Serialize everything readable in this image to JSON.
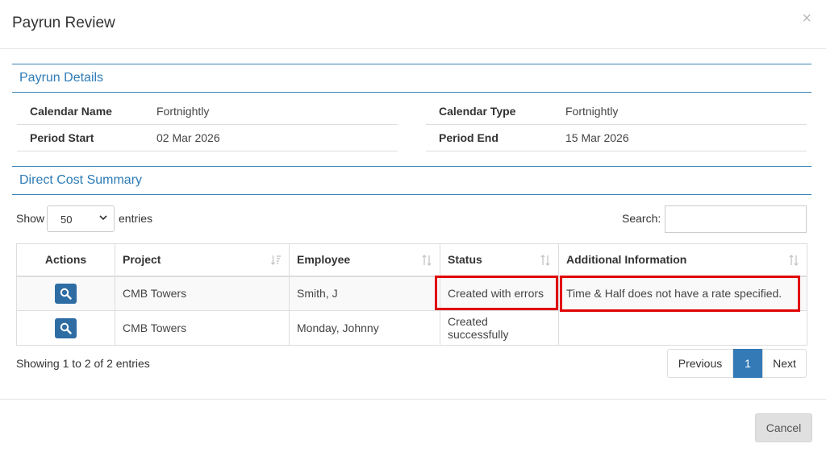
{
  "modal": {
    "title": "Payrun Review",
    "close": "×"
  },
  "payrun_details": {
    "heading": "Payrun Details",
    "fields": [
      {
        "label": "Calendar Name",
        "value": "Fortnightly"
      },
      {
        "label": "Calendar Type",
        "value": "Fortnightly"
      },
      {
        "label": "Period Start",
        "value": "02 Mar 2026"
      },
      {
        "label": "Period End",
        "value": "15 Mar 2026"
      }
    ]
  },
  "direct_cost": {
    "heading": "Direct Cost Summary",
    "length": {
      "show_label": "Show",
      "selected": "50",
      "entries_label": "entries"
    },
    "search": {
      "label": "Search:",
      "value": ""
    },
    "columns": [
      "Actions",
      "Project",
      "Employee",
      "Status",
      "Additional Information"
    ],
    "rows": [
      {
        "project": "CMB Towers",
        "employee": "Smith, J",
        "status": "Created with errors",
        "info": "Time & Half does not have a rate specified."
      },
      {
        "project": "CMB Towers",
        "employee": "Monday, Johnny",
        "status": "Created successfully",
        "info": ""
      }
    ],
    "info": "Showing 1 to 2 of 2 entries",
    "pagination": {
      "previous": "Previous",
      "current": "1",
      "next": "Next"
    }
  },
  "footer": {
    "cancel_label": "Cancel"
  },
  "colors": {
    "accent": "#337ab7",
    "highlight": "#e00000",
    "section_text": "#2c7bb6"
  },
  "icons": {
    "view": "search-icon",
    "close": "close-icon",
    "sort": "sort-icon",
    "dropdown": "chevron-down-icon"
  }
}
